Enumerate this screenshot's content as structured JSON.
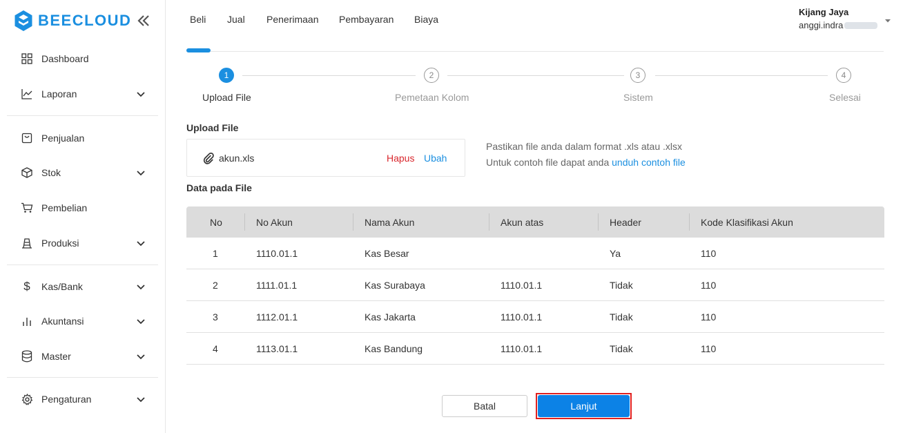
{
  "brand": {
    "name": "BEECLOUD",
    "color": "#1b8fe0"
  },
  "sidebar": {
    "items": [
      {
        "label": "Dashboard",
        "icon": "dashboard-grid-icon",
        "has_children": false
      },
      {
        "label": "Laporan",
        "icon": "chart-line-icon",
        "has_children": true
      },
      {
        "label": "Penjualan",
        "icon": "shopping-bag-icon",
        "has_children": false
      },
      {
        "label": "Stok",
        "icon": "box-icon",
        "has_children": true
      },
      {
        "label": "Pembelian",
        "icon": "cart-icon",
        "has_children": false
      },
      {
        "label": "Produksi",
        "icon": "factory-icon",
        "has_children": true
      },
      {
        "label": "Kas/Bank",
        "icon": "dollar-icon",
        "has_children": true
      },
      {
        "label": "Akuntansi",
        "icon": "bar-chart-icon",
        "has_children": true
      },
      {
        "label": "Master",
        "icon": "database-icon",
        "has_children": true
      },
      {
        "label": "Pengaturan",
        "icon": "gear-icon",
        "has_children": true
      }
    ]
  },
  "topnav": {
    "items": [
      "Beli",
      "Jual",
      "Penerimaan",
      "Pembayaran",
      "Biaya"
    ],
    "user": {
      "company": "Kijang Jaya",
      "email": "anggi.indra"
    }
  },
  "stepper": {
    "steps": [
      {
        "number": "1",
        "label": "Upload File",
        "active": true
      },
      {
        "number": "2",
        "label": "Pemetaan Kolom",
        "active": false
      },
      {
        "number": "3",
        "label": "Sistem",
        "active": false
      },
      {
        "number": "4",
        "label": "Selesai",
        "active": false
      }
    ]
  },
  "upload": {
    "title": "Upload File",
    "file_name": "akun.xls",
    "remove_label": "Hapus",
    "change_label": "Ubah",
    "hint_line1": "Pastikan file anda dalam format .xls atau .xlsx",
    "hint_line2_prefix": "Untuk contoh file dapat anda ",
    "hint_link": "unduh contoh file"
  },
  "data_table": {
    "title": "Data pada File",
    "columns": [
      "No",
      "No Akun",
      "Nama Akun",
      "Akun atas",
      "Header",
      "Kode Klasifikasi Akun"
    ],
    "rows": [
      [
        "1",
        "1110.01.1",
        "Kas Besar",
        "",
        "Ya",
        "110"
      ],
      [
        "2",
        "1111.01.1",
        "Kas Surabaya",
        "1110.01.1",
        "Tidak",
        "110"
      ],
      [
        "3",
        "1112.01.1",
        "Kas Jakarta",
        "1110.01.1",
        "Tidak",
        "110"
      ],
      [
        "4",
        "1113.01.1",
        "Kas Bandung",
        "1110.01.1",
        "Tidak",
        "110"
      ]
    ]
  },
  "actions": {
    "cancel_label": "Batal",
    "next_label": "Lanjut"
  },
  "colors": {
    "accent": "#1b8fe0",
    "danger": "#d9262c",
    "highlight": "#e0201f",
    "primary_button": "#0c82e6"
  }
}
